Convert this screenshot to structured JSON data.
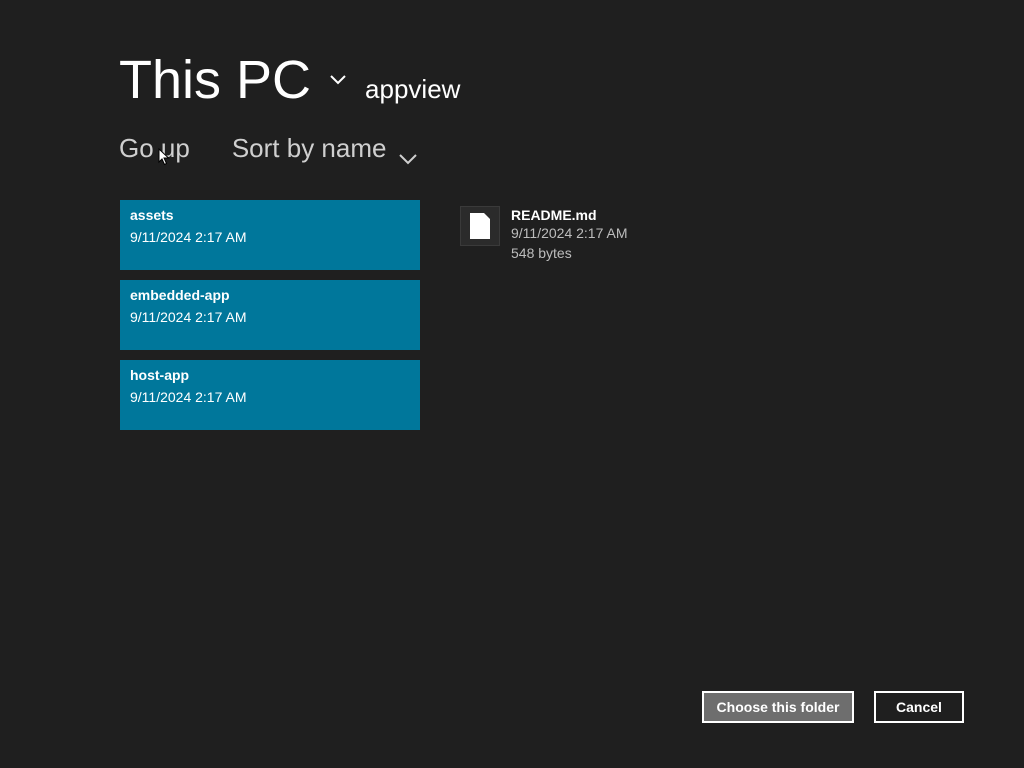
{
  "header": {
    "location": "This PC",
    "folder": "appview"
  },
  "toolbar": {
    "go_up": "Go up",
    "sort_by": "Sort by name"
  },
  "folders": [
    {
      "name": "assets",
      "date": "9/11/2024 2:17 AM"
    },
    {
      "name": "embedded-app",
      "date": "9/11/2024 2:17 AM"
    },
    {
      "name": "host-app",
      "date": "9/11/2024 2:17 AM"
    }
  ],
  "files": [
    {
      "name": "README.md",
      "date": "9/11/2024 2:17 AM",
      "size": "548 bytes"
    }
  ],
  "buttons": {
    "choose_folder": "Choose this folder",
    "cancel": "Cancel"
  },
  "colors": {
    "background": "#1f1f1f",
    "folder_tile": "#00779b",
    "primary_button": "#6e6e6e"
  },
  "icons": {
    "location_dropdown": "chevron-down-icon",
    "sort_dropdown": "chevron-down-icon",
    "file": "document-icon",
    "cursor": "mouse-pointer-icon"
  }
}
